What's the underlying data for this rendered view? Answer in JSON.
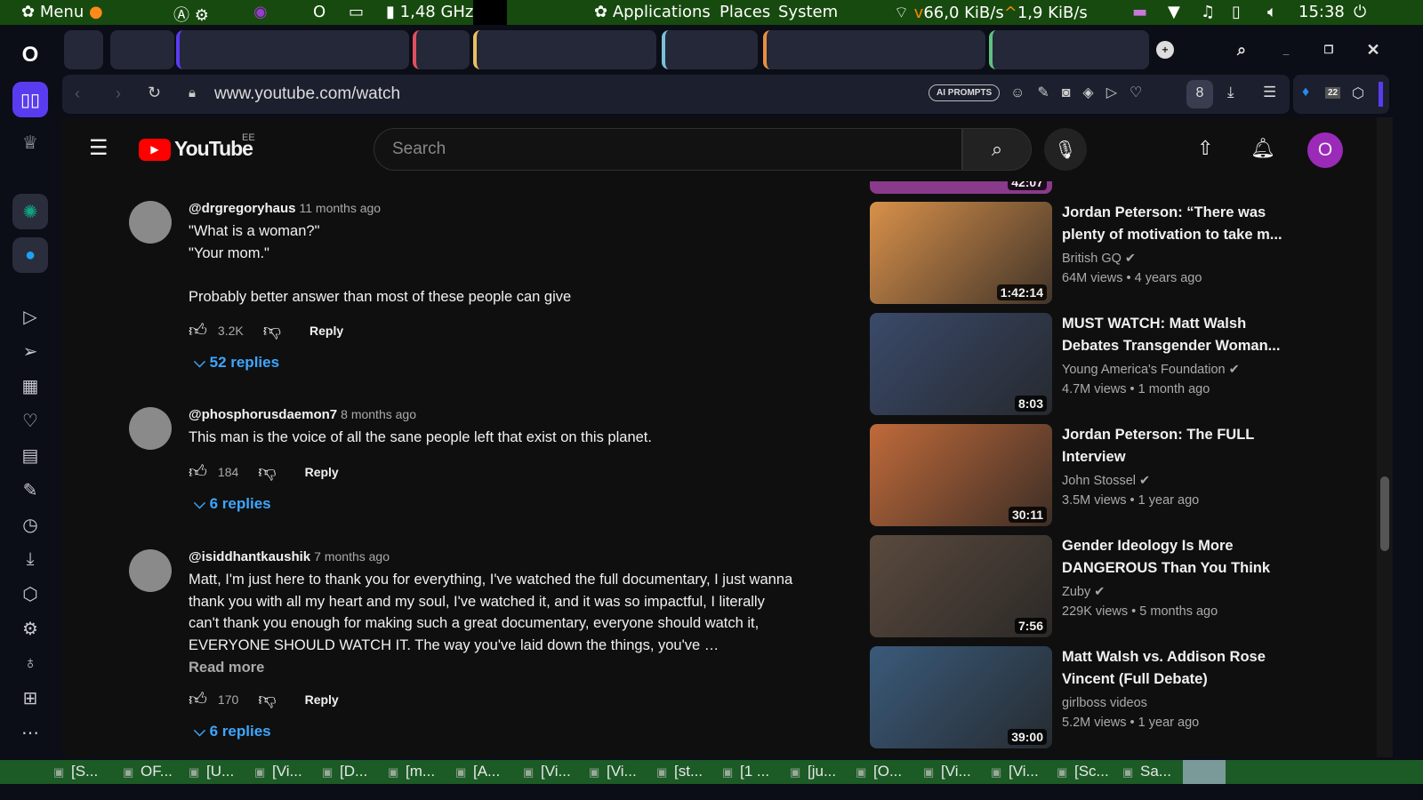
{
  "panel": {
    "menu": "Menu",
    "cpu": "1,48 GHz",
    "applications": "Applications",
    "places": "Places",
    "system": "System",
    "down": "66,0 KiB/s",
    "up": "1,9 KiB/s",
    "clock": "15:38"
  },
  "browser": {
    "url": "www.youtube.com/watch",
    "ai_prompts": "AI PROMPTS",
    "badge": "22"
  },
  "youtube": {
    "logo": "YouTube",
    "region": "EE",
    "search_placeholder": "Search",
    "avatar_letter": "O"
  },
  "comments": [
    {
      "author": "@drgregoryhaus",
      "time": "11 months ago",
      "text": "\"What is a woman?\"\n\"Your mom.\"\n\nProbably better answer than most of these people can give",
      "likes": "3.2K",
      "reply": "Reply",
      "replies": "52 replies",
      "liked": true
    },
    {
      "author": "@phosphorusdaemon7",
      "time": "8 months ago",
      "text": "This man is the voice of all the sane people left that exist on this planet.",
      "likes": "184",
      "reply": "Reply",
      "replies": "6 replies"
    },
    {
      "author": "@isiddhantkaushik",
      "time": "7 months ago",
      "text": "Matt, I'm just here to thank you for everything, I've watched the full documentary, I just wanna thank you with all my heart and my soul, I've watched it, and it was so impactful, I literally can't thank you enough for making such a great documentary, everyone should watch it, EVERYONE SHOULD WATCH IT. The way you've laid down the things, you've …",
      "read_more": "Read more",
      "likes": "170",
      "reply": "Reply",
      "replies": "6 replies"
    }
  ],
  "partial_video_duration": "42:07",
  "videos": [
    {
      "title": "Jordan Peterson: “There was plenty of motivation to take m...",
      "channel": "British GQ",
      "verified": true,
      "views": "64M views",
      "age": "4 years ago",
      "duration": "1:42:14",
      "color": "#d8904a"
    },
    {
      "title": "MUST WATCH: Matt Walsh Debates Transgender Woman...",
      "channel": "Young America's Foundation",
      "verified": true,
      "views": "4.7M views",
      "age": "1 month ago",
      "duration": "8:03",
      "color": "#3a4a6a"
    },
    {
      "title": "Jordan Peterson: The FULL Interview",
      "channel": "John Stossel",
      "verified": true,
      "views": "3.5M views",
      "age": "1 year ago",
      "duration": "30:11",
      "color": "#c06a3a"
    },
    {
      "title": "Gender Ideology Is More DANGEROUS Than You Think -...",
      "channel": "Zuby",
      "verified": true,
      "views": "229K views",
      "age": "5 months ago",
      "duration": "7:56",
      "color": "#5a4a3e"
    },
    {
      "title": "Matt Walsh vs. Addison Rose Vincent (Full Debate)",
      "channel": "girlboss videos",
      "verified": false,
      "views": "5.2M views",
      "age": "1 year ago",
      "duration": "39:00",
      "color": "#3a5a7a"
    }
  ],
  "taskbar": [
    "[S...",
    "OF...",
    "[U...",
    "[Vi...",
    "[D...",
    "[m...",
    "[A...",
    "[Vi...",
    "[Vi...",
    "[st...",
    "[1 ...",
    "[ju...",
    "[O...",
    "[Vi...",
    "[Vi...",
    "[Sc...",
    "Sa..."
  ]
}
